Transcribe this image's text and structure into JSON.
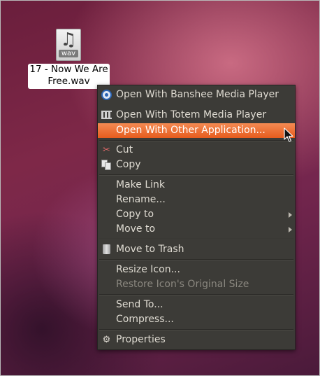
{
  "desktop": {
    "file": {
      "icon": "audio-wav-file-icon",
      "extension": "wav",
      "name_line1": "17 - Now We Are",
      "name_line2": "Free.wav"
    }
  },
  "context_menu": {
    "items": [
      {
        "label": "Open With Banshee Media Player",
        "icon": "banshee-icon"
      },
      {
        "label": "Open With Totem Media Player",
        "icon": "totem-icon"
      },
      {
        "label": "Open With Other Application...",
        "highlighted": true
      },
      {
        "label": "Cut",
        "icon": "scissors-icon"
      },
      {
        "label": "Copy",
        "icon": "copy-icon"
      },
      {
        "label": "Make Link"
      },
      {
        "label": "Rename..."
      },
      {
        "label": "Copy to",
        "submenu": true
      },
      {
        "label": "Move to",
        "submenu": true
      },
      {
        "label": "Move to Trash",
        "icon": "trash-icon"
      },
      {
        "label": "Resize Icon..."
      },
      {
        "label": "Restore Icon's Original Size",
        "disabled": true
      },
      {
        "label": "Send To..."
      },
      {
        "label": "Compress..."
      },
      {
        "label": "Properties",
        "icon": "gear-icon"
      }
    ]
  },
  "colors": {
    "highlight": "#f07746",
    "menu_bg": "#3c3b37",
    "menu_text": "#dfdbd2",
    "disabled_text": "#8a877f"
  }
}
